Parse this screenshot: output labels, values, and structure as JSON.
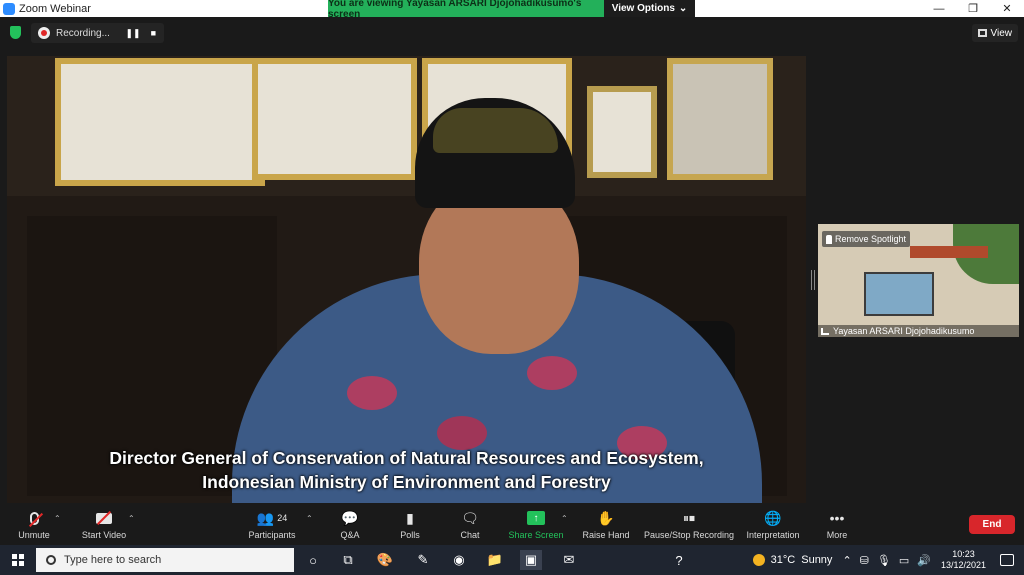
{
  "window": {
    "title": "Zoom Webinar",
    "minimize": "—",
    "restore": "❐",
    "close": "✕"
  },
  "banner": {
    "viewing_text": "You are viewing Yayasan ARSARI Djojohadikusumo's screen",
    "view_options_label": "View Options",
    "view_options_caret": "⌄"
  },
  "topbar": {
    "recording_label": "Recording...",
    "pause_symbol": "❚❚",
    "stop_symbol": "■",
    "view_label": "View"
  },
  "main_video": {
    "caption_line1": "Director General of Conservation of Natural Resources and Ecosystem,",
    "caption_line2": "Indonesian Ministry of Environment and Forestry"
  },
  "thumbnail": {
    "remove_spotlight": "Remove Spotlight",
    "participant_name": "Yayasan ARSARI Djojohadikusumo"
  },
  "toolbar": {
    "unmute": "Unmute",
    "start_video": "Start Video",
    "participants": "Participants",
    "participants_count": "24",
    "qa": "Q&A",
    "polls": "Polls",
    "chat": "Chat",
    "share_screen": "Share Screen",
    "raise_hand": "Raise Hand",
    "pause_stop_recording": "Pause/Stop Recording",
    "interpretation": "Interpretation",
    "more": "More",
    "end": "End",
    "caret": "⌃"
  },
  "taskbar": {
    "search_placeholder": "Type here to search",
    "weather_temp": "31°C",
    "weather_text": "Sunny",
    "time": "10:23",
    "date": "13/12/2021"
  },
  "colors": {
    "zoom_blue": "#2d8cff",
    "green_banner": "#23b05a",
    "end_red": "#d8262b",
    "toolbar_bg": "#1a1a1a"
  }
}
